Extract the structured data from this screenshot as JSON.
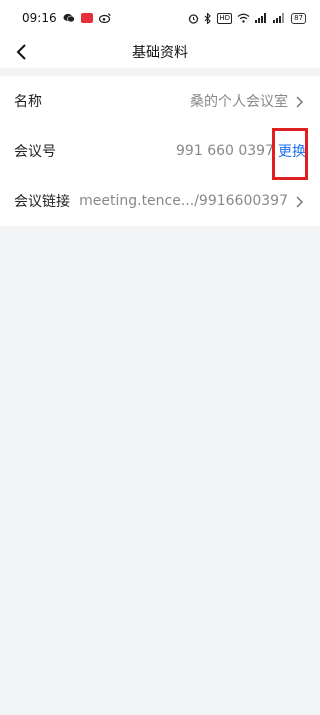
{
  "status_bar": {
    "time": "09:16",
    "battery": "87",
    "icons": [
      "wechat-icon",
      "red-app-icon",
      "weibo-icon",
      "alarm-icon",
      "bluetooth-icon",
      "hd-badge",
      "wifi-icon",
      "signal-icon",
      "signal-icon",
      "battery-icon"
    ]
  },
  "nav": {
    "title": "基础资料",
    "back_icon": "back-chevron-icon"
  },
  "rows": [
    {
      "label": "名称",
      "value": "桑的个人会议室"
    },
    {
      "label": "会议号",
      "value": "991 660 0397",
      "action": "更换"
    },
    {
      "label": "会议链接",
      "value": "meeting.tence.../9916600397"
    }
  ],
  "colors": {
    "link": "#1f6ff0",
    "highlight": "#e02020"
  }
}
